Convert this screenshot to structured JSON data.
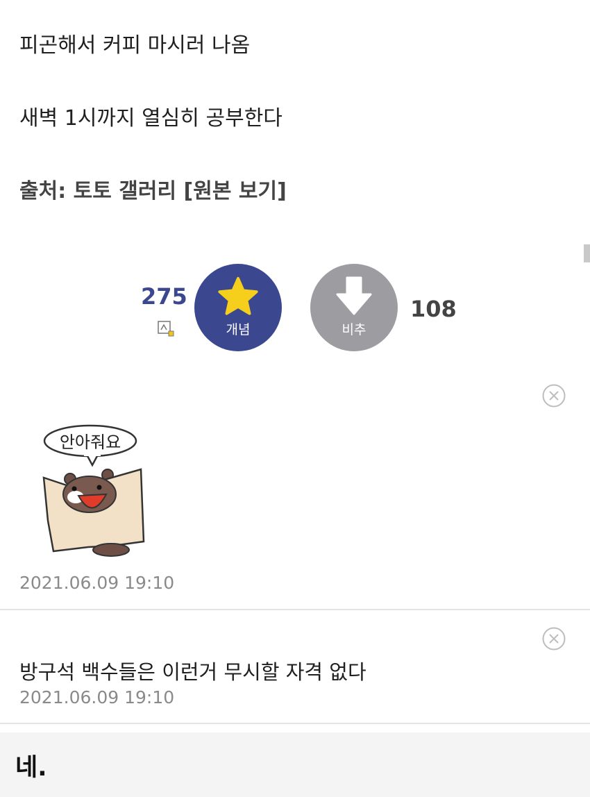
{
  "post": {
    "lines": [
      "피곤해서 커피 마시러 나옴",
      "새벽 1시까지 열심히 공부한다"
    ],
    "source_line": "출처: 토토 갤러리 [원본 보기]"
  },
  "votes": {
    "up_count": "275",
    "up_label": "개념",
    "down_count": "108",
    "down_label": "비추",
    "up_color": "#3b4890",
    "down_color": "#9c9ca1"
  },
  "comments": [
    {
      "sticker_text": "안아줘요",
      "timestamp": "2021.06.09 19:10",
      "icon": "close-circle-icon"
    },
    {
      "text": "방구석 백수들은 이런거 무시할 자격 없다",
      "timestamp": "2021.06.09 19:10",
      "icon": "close-circle-icon"
    }
  ],
  "reply": {
    "text": "네."
  }
}
